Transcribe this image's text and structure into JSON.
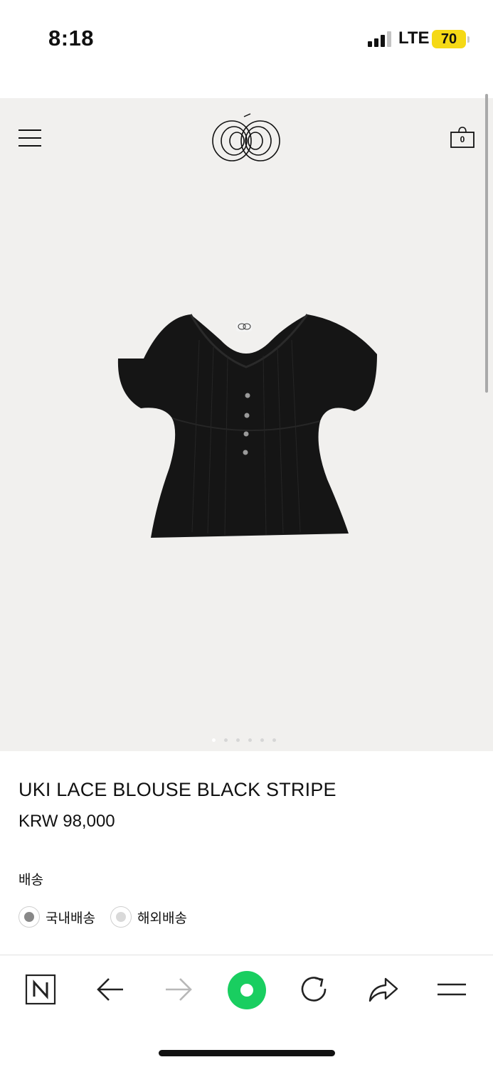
{
  "status_bar": {
    "time": "8:18",
    "network": "LTE",
    "battery": "70"
  },
  "header": {
    "menu_icon": "hamburger-menu-icon",
    "logo_icon": "brand-logo-icon",
    "cart_icon": "shopping-bag-icon",
    "cart_count": "0"
  },
  "gallery": {
    "slide_count": 6,
    "active_slide": 1
  },
  "product": {
    "title": "UKI LACE BLOUSE BLACK STRIPE",
    "price": "KRW 98,000"
  },
  "shipping": {
    "label": "배송",
    "options": [
      {
        "label": "국내배송",
        "selected": true
      },
      {
        "label": "해외배송",
        "selected": false
      }
    ]
  },
  "browser_toolbar": {
    "icons": [
      "naver-home-icon",
      "back-arrow-icon",
      "forward-arrow-icon",
      "green-circle-icon",
      "reload-icon",
      "share-icon",
      "menu-icon"
    ]
  },
  "colors": {
    "background": "#f1f0ee",
    "accent_green": "#19ce60",
    "battery_yellow": "#f5d915"
  }
}
